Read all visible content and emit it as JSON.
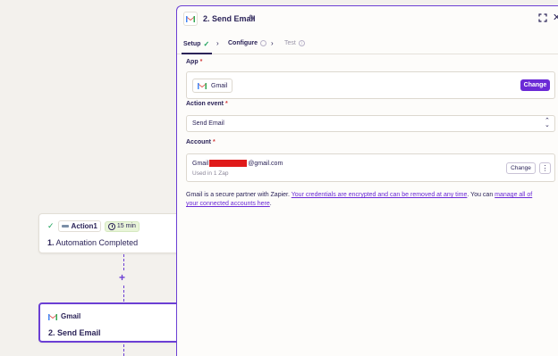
{
  "canvas": {
    "step1": {
      "check": "✓",
      "app_name": "Action1",
      "timer": "15 min",
      "number": "1.",
      "title": "Automation Completed"
    },
    "plus": "+",
    "step2": {
      "app_name": "Gmail",
      "number": "2.",
      "title": "Send Email"
    }
  },
  "panel": {
    "title": "2. Send Email",
    "tabs": [
      {
        "label": "Setup",
        "status": "complete"
      },
      {
        "label": "Configure",
        "status": "pending"
      },
      {
        "label": "Test",
        "status": "disabled"
      }
    ],
    "app": {
      "label": "App",
      "required": "*",
      "value": "Gmail",
      "change_label": "Change"
    },
    "action_event": {
      "label": "Action event",
      "required": "*",
      "value": "Send Email"
    },
    "account": {
      "label": "Account",
      "required": "*",
      "name_prefix": "Gmail",
      "name_suffix": "@gmail.com",
      "used_in": "Used in 1 Zap",
      "change_label": "Change",
      "more": "⋮"
    },
    "footnote": {
      "text1": "Gmail is a secure partner with Zapier. ",
      "link1": "Your credentials are encrypted and can be removed at any time",
      "text2": ". You can ",
      "link2": "manage all of your connected accounts here",
      "text3": "."
    }
  },
  "colors": {
    "accent": "#6b2ad6",
    "success": "#18a058",
    "required": "#d23a3a",
    "redaction": "#e01a1a"
  }
}
